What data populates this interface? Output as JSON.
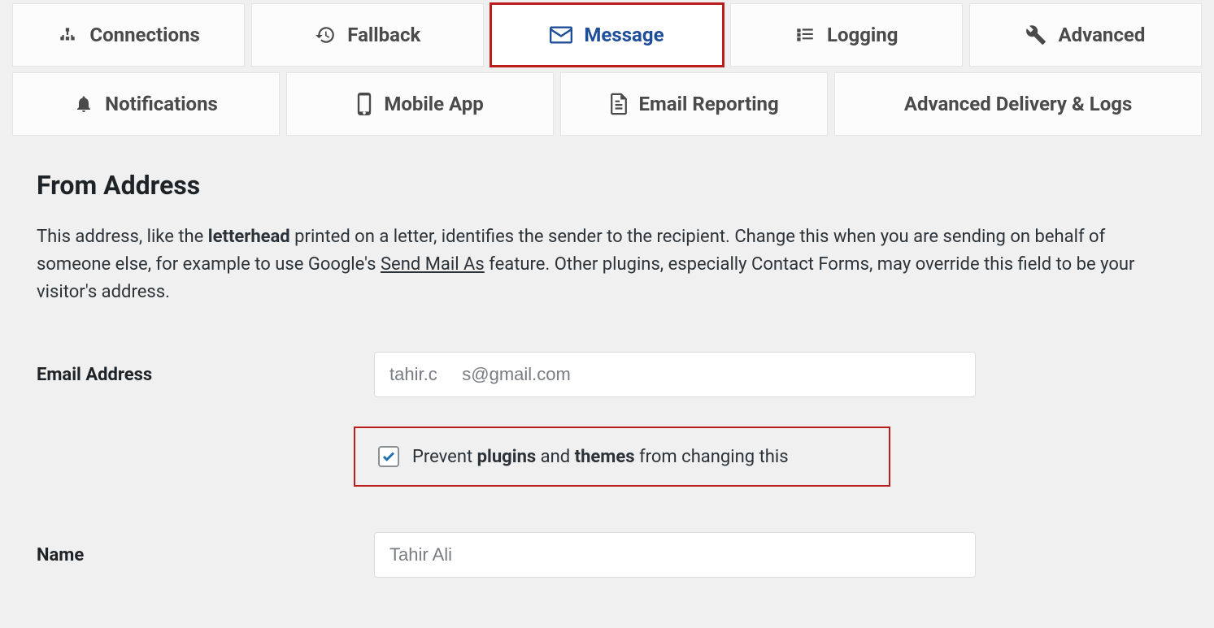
{
  "tabs_row1": {
    "connections": "Connections",
    "fallback": "Fallback",
    "message": "Message",
    "logging": "Logging",
    "advanced": "Advanced"
  },
  "tabs_row2": {
    "notifications": "Notifications",
    "mobile_app": "Mobile App",
    "email_reporting": "Email Reporting",
    "adv_delivery": "Advanced Delivery & Logs"
  },
  "section": {
    "title": "From Address",
    "desc_part1": "This address, like the ",
    "desc_bold1": "letterhead",
    "desc_part2": " printed on a letter, identifies the sender to the recipient. Change this when you are sending on behalf of someone else, for example to use Google's ",
    "desc_link": "Send Mail As",
    "desc_part3": " feature. Other plugins, especially Contact Forms, may override this field to be your visitor's address."
  },
  "form": {
    "email_label": "Email Address",
    "email_value": "tahir.c     s@gmail.com",
    "prevent_pre": "Prevent ",
    "prevent_b1": "plugins",
    "prevent_mid": " and ",
    "prevent_b2": "themes",
    "prevent_post": " from changing this",
    "name_label": "Name",
    "name_value": "Tahir Ali"
  }
}
